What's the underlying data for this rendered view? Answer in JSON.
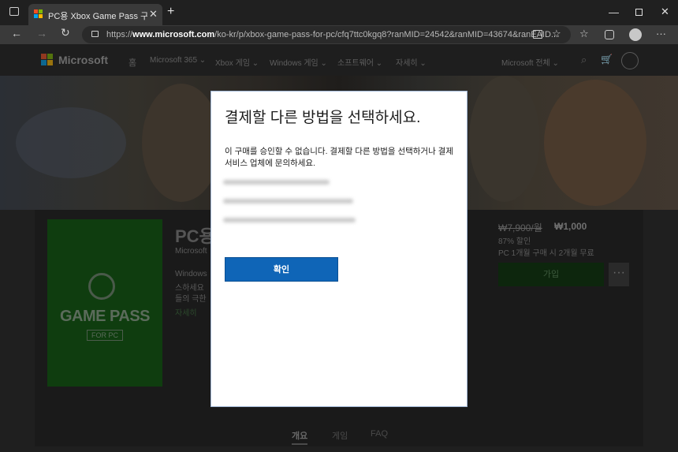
{
  "browser": {
    "tab_title": "PC용 Xbox Game Pass 구매 - Mic",
    "url_prefix": "https://",
    "url_host": "www.microsoft.com",
    "url_path": "/ko-kr/p/xbox-game-pass-for-pc/cfq7ttc0kgq8?ranMID=24542&ranMID=43674&ranEAID..."
  },
  "ms_nav": {
    "brand": "Microsoft",
    "home": "홈",
    "items": [
      "Microsoft 365 ⌄",
      "Xbox 게임 ⌄",
      "Windows 게임 ⌄",
      "소프트웨어 ⌄",
      "자세히 ⌄"
    ],
    "all_microsoft": "Microsoft 전체 ⌄"
  },
  "product": {
    "title_partial": "PC용",
    "publisher_partial": "Microsoft",
    "desc_line1": "Windows",
    "desc_line2": "스하세요",
    "desc_line3": "들의 극한",
    "more_link": "자세히",
    "logo_text": "GAME PASS",
    "logo_sub": "FOR PC",
    "old_price": "₩7,900/월",
    "new_price": "₩1,000",
    "discount": "87% 할인",
    "promo": "PC 1개월 구매 시 2개월 무료",
    "buy_label": "가입",
    "more_label": "···"
  },
  "subtabs": [
    "개요",
    "게임",
    "FAQ"
  ],
  "modal": {
    "heading": "결제할 다른 방법을 선택하세요.",
    "message": "이 구매를 승인할 수 없습니다. 결제할 다른 방법을 선택하거나 결제 서비스 업체에 문의하세요.",
    "ok_label": "확인"
  },
  "colors": {
    "primary_button": "#0f65b7",
    "chrome_dark": "#202020",
    "gamepass_green": "#0f3d0f"
  }
}
